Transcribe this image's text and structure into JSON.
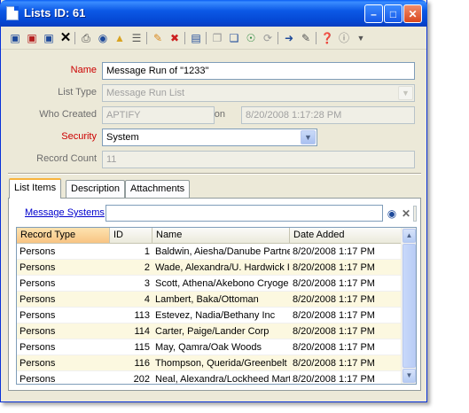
{
  "window": {
    "title": "Lists ID: 61"
  },
  "form": {
    "name_label": "Name",
    "name_value": "Message Run of \"1233\"",
    "list_type_label": "List Type",
    "list_type_value": "Message Run List",
    "who_created_label": "Who Created",
    "who_created_value": "APTIFY",
    "on_label": "on",
    "on_value": "8/20/2008 1:17:28 PM",
    "security_label": "Security",
    "security_value": "System",
    "record_count_label": "Record Count",
    "record_count_value": "11"
  },
  "tabs": [
    "List Items",
    "Description",
    "Attachments"
  ],
  "list_items": {
    "link_label": "Message Systems",
    "columns": [
      "Record Type",
      "ID",
      "Name",
      "Date Added"
    ],
    "rows": [
      [
        "Persons",
        "1",
        "Baldwin, Aiesha/Danube Partne",
        "8/20/2008 1:17 PM"
      ],
      [
        "Persons",
        "2",
        "Wade, Alexandra/U. Hardwick I",
        "8/20/2008 1:17 PM"
      ],
      [
        "Persons",
        "3",
        "Scott, Athena/Akebono Cryoge",
        "8/20/2008 1:17 PM"
      ],
      [
        "Persons",
        "4",
        "Lambert, Baka/Ottoman",
        "8/20/2008 1:17 PM"
      ],
      [
        "Persons",
        "113",
        "Estevez, Nadia/Bethany Inc",
        "8/20/2008 1:17 PM"
      ],
      [
        "Persons",
        "114",
        "Carter, Paige/Lander Corp",
        "8/20/2008 1:17 PM"
      ],
      [
        "Persons",
        "115",
        "May, Qamra/Oak Woods",
        "8/20/2008 1:17 PM"
      ],
      [
        "Persons",
        "116",
        "Thompson, Querida/Greenbelt I",
        "8/20/2008 1:17 PM"
      ],
      [
        "Persons",
        "202",
        "Neal, Alexandra/Lockheed Mart",
        "8/20/2008 1:17 PM"
      ]
    ]
  },
  "colors": {
    "required_label": "#cc0000",
    "link": "#0000cc",
    "title_bar": "#0c59e6",
    "row_highlight": "#fcf8e0",
    "sorted_header": "#f8c483"
  },
  "icons": {
    "titlebar": [
      "minimize-icon",
      "maximize-icon",
      "close-icon"
    ],
    "toolbar": [
      "save-icon",
      "save-new-icon",
      "save-close-icon",
      "delete-icon",
      "print-icon",
      "find-icon",
      "open-folder-icon",
      "list-icon",
      "edit-icon",
      "delete-record-icon",
      "grid-icon",
      "copy-icon",
      "copy-to-icon",
      "web-icon",
      "refresh-icon",
      "go-to-icon",
      "notes-icon",
      "help-icon",
      "info-icon"
    ],
    "grid_search": [
      "binoculars-icon",
      "clear-icon"
    ]
  }
}
